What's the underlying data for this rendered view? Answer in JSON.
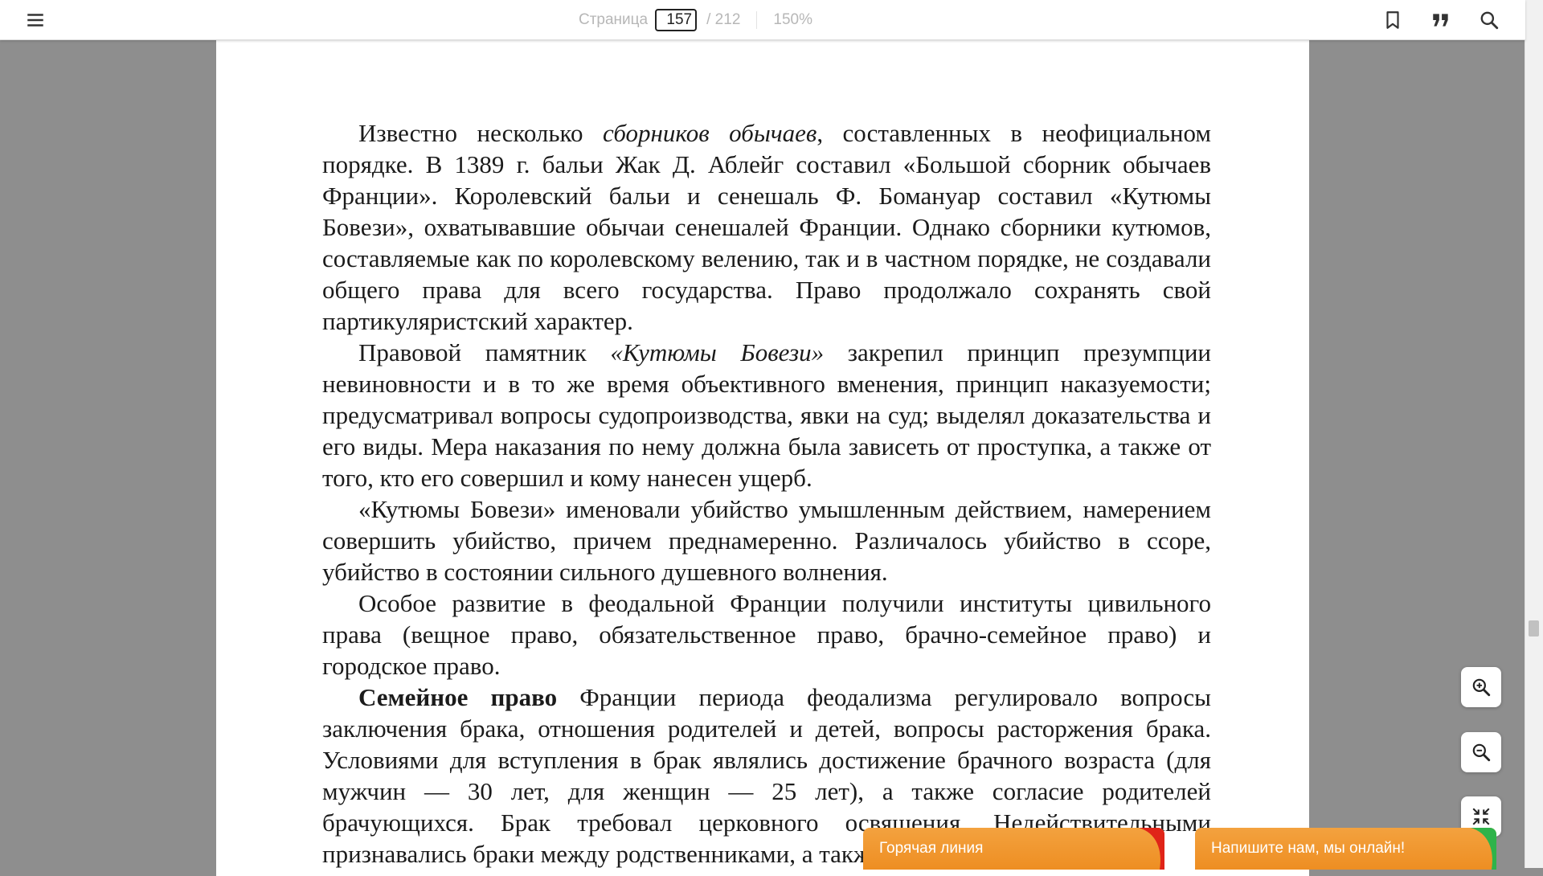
{
  "toolbar": {
    "menu_icon": "hamburger-menu-icon",
    "page_label": "Страница",
    "current_page": "157",
    "total_pages": "/ 212",
    "zoom": "150%",
    "bookmark_icon": "bookmark-icon",
    "quote_icon": "quote-icon",
    "search_icon": "search-icon"
  },
  "page": {
    "p1_a": "Известно несколько ",
    "p1_b": "сборников обычаев",
    "p1_c": ", составленных в неофициальном порядке. В 1389 г. бальи Жак Д. Аблейг составил «Большой сборник обычаев Франции». Королевский бальи и сенешаль Ф. Бомануар составил «Кутюмы Бовези», охватывавшие обычаи сенешалей Франции. Однако сборники кутюмов, составляемые как по королевскому велению, так и в частном порядке, не создавали общего права для всего государства. Право продолжало сохранять свой партикуляристский характер.",
    "p2_a": "Правовой памятник ",
    "p2_b": "«Кутюмы Бовези»",
    "p2_c": " закрепил принцип презумпции невиновности и в то же время объективного вменения, принцип наказуемости; предусматривал вопросы судопроизводства, явки на суд; выделял доказательства и его виды. Мера наказания по нему должна была зависеть от проступка, а также от того, кто его совершил и кому нанесен ущерб.",
    "p3": "«Кутюмы Бовези» именовали убийство умышленным действием, намерением совершить убийство, причем преднамеренно. Различалось убийство в ссоре, убийство в состоянии сильного душевного волнения.",
    "p4": "Особое развитие в феодальной Франции получили институты цивильного права (вещное право, обязательственное право, брачно-семейное право) и городское право.",
    "p5_a": "Семейное право",
    "p5_b": " Франции периода феодализма регулировало вопросы заключения брака, отношения родителей и детей, вопросы расторжения брака. Условиями для вступления в брак являлись достижение брачного возраста (для мужчин — 30 лет, для женщин — 25 лет), а также согласие родителей брачующихся. Брак требовал церковного освящения. Недействительными признавались браки между родственниками, а также по"
  },
  "controls": {
    "zoom_in_icon": "zoom-in-icon",
    "zoom_out_icon": "zoom-out-icon",
    "fullscreen_exit_icon": "fullscreen-exit-icon"
  },
  "chat": {
    "hotline": "Горячая линия",
    "online": "Напишите нам, мы онлайн!"
  },
  "colors": {
    "chat_orange": "#f0952a",
    "page_bg": "#ffffff",
    "viewer_bg": "#8e8e8e"
  }
}
